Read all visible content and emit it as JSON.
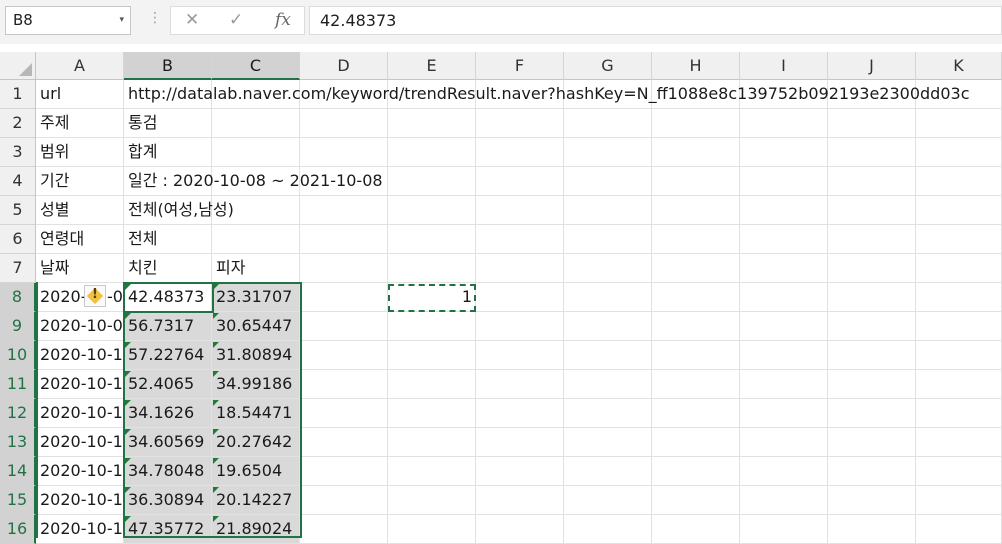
{
  "formula_bar": {
    "name_box": "B8",
    "name_box_dropdown": "▾",
    "separator": "⋮",
    "cancel_icon": "✕",
    "confirm_icon": "✓",
    "fx_label": "fx",
    "formula_value": "42.48373"
  },
  "columns": [
    "A",
    "B",
    "C",
    "D",
    "E",
    "F",
    "G",
    "H",
    "I",
    "J",
    "K"
  ],
  "rows": [
    {
      "num": "1",
      "a": "url",
      "b": "http://datalab.naver.com/keyword/trendResult.naver?hashKey=N_ff1088e8c139752b092193e2300dd03c",
      "c": ""
    },
    {
      "num": "2",
      "a": "주제",
      "b": "통검",
      "c": ""
    },
    {
      "num": "3",
      "a": "범위",
      "b": "합계",
      "c": ""
    },
    {
      "num": "4",
      "a": "기간",
      "b": "일간 : 2020-10-08 ~ 2021-10-08",
      "c": ""
    },
    {
      "num": "5",
      "a": "성별",
      "b": "전체(여성,남성)",
      "c": ""
    },
    {
      "num": "6",
      "a": "연령대",
      "b": "전체",
      "c": ""
    },
    {
      "num": "7",
      "a": "날짜",
      "b": "치킨",
      "c": "피자"
    },
    {
      "num": "8",
      "a": "2020-",
      "a2": "-0",
      "b": "42.48373",
      "c": "23.31707"
    },
    {
      "num": "9",
      "a": "2020-10-0",
      "b": "56.7317",
      "c": "30.65447"
    },
    {
      "num": "10",
      "a": "2020-10-1",
      "b": "57.22764",
      "c": "31.80894"
    },
    {
      "num": "11",
      "a": "2020-10-1",
      "b": "52.4065",
      "c": "34.99186"
    },
    {
      "num": "12",
      "a": "2020-10-1",
      "b": "34.1626",
      "c": "18.54471"
    },
    {
      "num": "13",
      "a": "2020-10-1",
      "b": "34.60569",
      "c": "20.27642"
    },
    {
      "num": "14",
      "a": "2020-10-1",
      "b": "34.78048",
      "c": "19.6504"
    },
    {
      "num": "15",
      "a": "2020-10-1",
      "b": "36.30894",
      "c": "20.14227"
    },
    {
      "num": "16",
      "a": "2020-10-1",
      "b": "47.35772",
      "c": "21.89024"
    }
  ],
  "e8_value": "1",
  "warning_icon": "!",
  "colors": {
    "accent": "#217346",
    "selection_fill": "#d9d9d9",
    "header_bg": "#f0f0f0"
  }
}
